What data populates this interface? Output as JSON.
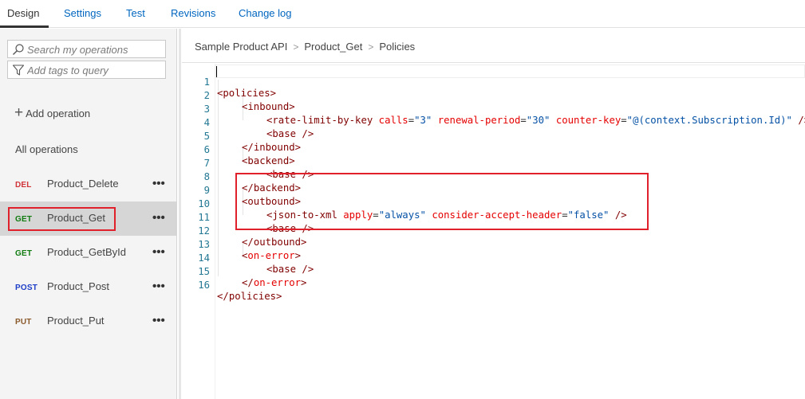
{
  "tabs": [
    {
      "label": "Design",
      "active": true
    },
    {
      "label": "Settings"
    },
    {
      "label": "Test"
    },
    {
      "label": "Revisions"
    },
    {
      "label": "Change log"
    }
  ],
  "sidebar": {
    "search_placeholder": "Search my operations",
    "tags_placeholder": "Add tags to query",
    "add_operation_label": "Add operation",
    "all_operations_label": "All operations",
    "operations": [
      {
        "verb": "DEL",
        "name": "Product_Delete",
        "color": "#d13438"
      },
      {
        "verb": "GET",
        "name": "Product_Get",
        "color": "#107c10",
        "selected": true
      },
      {
        "verb": "GET",
        "name": "Product_GetById",
        "color": "#107c10"
      },
      {
        "verb": "POST",
        "name": "Product_Post",
        "color": "#1e3ec8"
      },
      {
        "verb": "PUT",
        "name": "Product_Put",
        "color": "#8a5a2b"
      }
    ],
    "more_glyph": "•••"
  },
  "breadcrumb": {
    "api": "Sample Product API",
    "operation": "Product_Get",
    "section": "Policies",
    "separator": ">"
  },
  "editor": {
    "lines": [
      {
        "num": "1"
      },
      {
        "num": "2"
      },
      {
        "num": "3"
      },
      {
        "num": "4"
      },
      {
        "num": "5"
      },
      {
        "num": "6"
      },
      {
        "num": "7"
      },
      {
        "num": "8"
      },
      {
        "num": "9"
      },
      {
        "num": "10"
      },
      {
        "num": "11"
      },
      {
        "num": "12"
      },
      {
        "num": "13"
      },
      {
        "num": "14"
      },
      {
        "num": "15"
      },
      {
        "num": "16"
      }
    ],
    "code": {
      "l1": {
        "open": "<",
        "tag": "policies",
        "close": ">"
      },
      "l2": {
        "open": "<",
        "tag": "inbound",
        "close": ">"
      },
      "l3": {
        "open": "<",
        "tag": "rate-limit-by-key",
        "a1": "calls",
        "v1": "\"3\"",
        "a2": "renewal-period",
        "v2": "\"30\"",
        "a3": "counter-key",
        "v3": "\"@(context.Subscription.Id)\"",
        "close": " />"
      },
      "l4": {
        "open": "<",
        "tag": "base",
        "close": " />"
      },
      "l5": {
        "open": "</",
        "tag": "inbound",
        "close": ">"
      },
      "l6": {
        "open": "<",
        "tag": "backend",
        "close": ">"
      },
      "l7": {
        "open": "<",
        "tag": "base",
        "close": " />"
      },
      "l8": {
        "open": "</",
        "tag": "backend",
        "close": ">"
      },
      "l9": {
        "open": "<",
        "tag": "outbound",
        "close": ">"
      },
      "l10": {
        "open": "<",
        "tag": "json-to-xml",
        "a1": "apply",
        "v1": "\"always\"",
        "a2": "consider-accept-header",
        "v2": "\"false\"",
        "close": " />"
      },
      "l11": {
        "open": "<",
        "tag": "base",
        "close": " />"
      },
      "l12": {
        "open": "</",
        "tag": "outbound",
        "close": ">"
      },
      "l13": {
        "open": "<",
        "tag": "on-error",
        "close": ">"
      },
      "l14": {
        "open": "<",
        "tag": "base",
        "close": " />"
      },
      "l15": {
        "open": "</",
        "tag": "on-error",
        "close": ">"
      },
      "l16": {
        "open": "</",
        "tag": "policies",
        "close": ">"
      }
    }
  },
  "colors": {
    "link": "#0066c0",
    "highlight_box": "#e0202a",
    "tag": "#800000",
    "attribute": "#e50000",
    "value": "#0451a5",
    "line_number": "#237893"
  }
}
